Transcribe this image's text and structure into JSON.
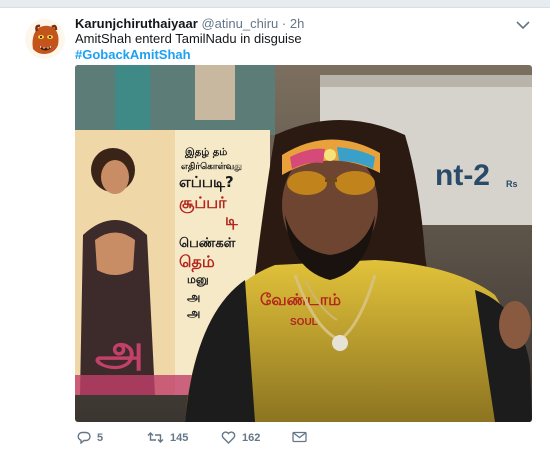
{
  "tweet": {
    "display_name": "Karunjchiruthaiyaar",
    "handle": "@atinu_chiru",
    "separator": "·",
    "time": "2h",
    "text": "AmitShah enterd TamilNadu in disguise",
    "hashtag": "#GobackAmitShah"
  },
  "media": {
    "sign_text": "nt-2",
    "sign_text_small": "Rs",
    "poster_lines": [
      "இதழ் தம்",
      "எதிர்கொள்வது",
      "எப்படி?",
      "சூப்பர்",
      "டி",
      "பெண்கள்",
      "தெம்",
      "மனு",
      "அ",
      "அ"
    ],
    "poster_big_word": "அ",
    "shirt_text": "வேண்டாம்",
    "shirt_text_small": "SOUL"
  },
  "actions": {
    "reply_count": "5",
    "retweet_count": "145",
    "like_count": "162"
  },
  "icons": {
    "reply": "reply-icon",
    "retweet": "retweet-icon",
    "like": "heart-icon",
    "dm": "envelope-icon",
    "menu": "chevron-down-icon"
  },
  "colors": {
    "link": "#1da1f2",
    "meta": "#657786",
    "text": "#14171a"
  }
}
